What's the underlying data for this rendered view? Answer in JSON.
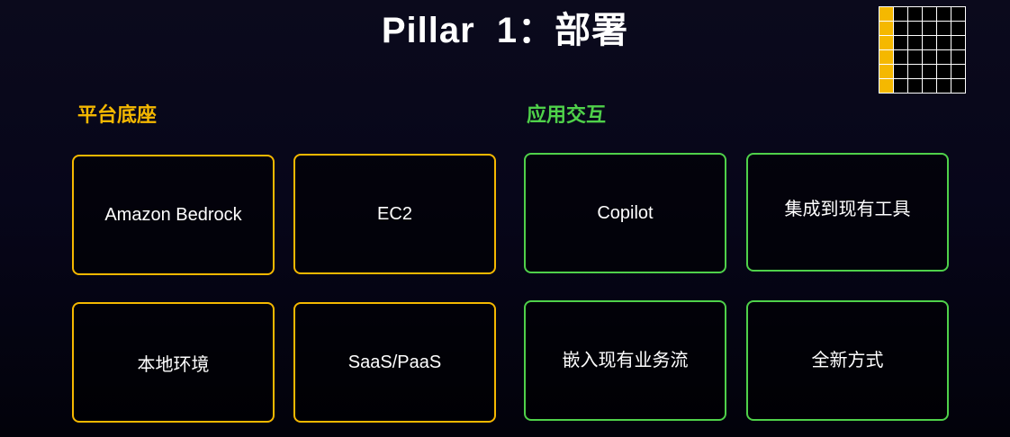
{
  "slide": {
    "title": "Pillar  1：部署"
  },
  "colors": {
    "platform_accent": "#f5b800",
    "interaction_accent": "#4fd14a",
    "background": "#07061a"
  },
  "grid_icon": {
    "rows": 6,
    "cols": 6,
    "filled_columns": 1,
    "icon_name": "grid-progress-icon"
  },
  "sections": {
    "platform": {
      "heading": "平台底座",
      "cards": [
        "Amazon Bedrock",
        "EC2",
        "本地环境",
        "SaaS/PaaS"
      ]
    },
    "interaction": {
      "heading": "应用交互",
      "cards": [
        "Copilot",
        "集成到现有工具",
        "嵌入现有业务流",
        "全新方式"
      ]
    }
  }
}
